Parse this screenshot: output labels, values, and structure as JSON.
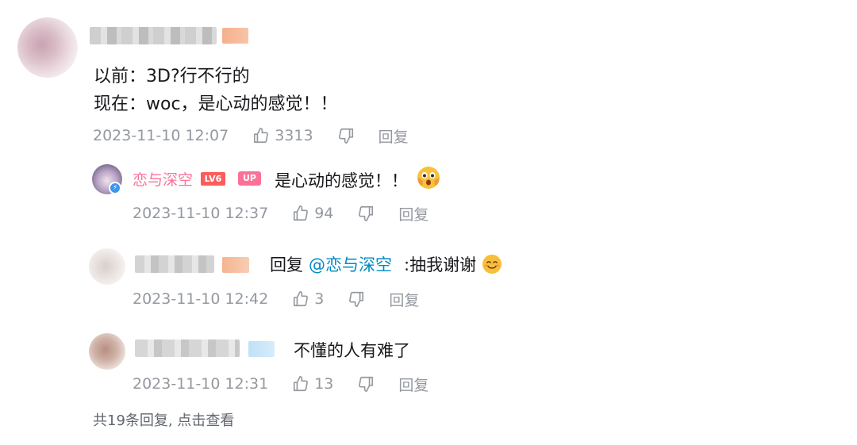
{
  "main_comment": {
    "line1": "以前：3D?行不行的",
    "line2": "现在：woc，是心动的感觉！！",
    "time": "2023-11-10 12:07",
    "likes": "3313",
    "reply_label": "回复"
  },
  "replies": [
    {
      "username": "恋与深空",
      "level_badge": "LV6",
      "up_badge": "UP",
      "text": "是心动的感觉！！",
      "emoji": "shocked-face",
      "time": "2023-11-10 12:37",
      "likes": "94",
      "reply_label": "回复"
    },
    {
      "reply_prefix": "回复",
      "mention": "@恋与深空",
      "text": ":抽我谢谢",
      "emoji": "smile-face",
      "time": "2023-11-10 12:42",
      "likes": "3",
      "reply_label": "回复"
    },
    {
      "text": "不懂的人有难了",
      "time": "2023-11-10 12:31",
      "likes": "13",
      "reply_label": "回复"
    }
  ],
  "view_all": "共19条回复, 点击查看",
  "colors": {
    "username_pink": "#fb7299",
    "mention_blue": "#008ac5",
    "meta_gray": "#9499a0",
    "level_red": "#fb5d5d"
  },
  "icons": [
    "thumbs-up-icon",
    "thumbs-down-icon",
    "verified-icon"
  ]
}
